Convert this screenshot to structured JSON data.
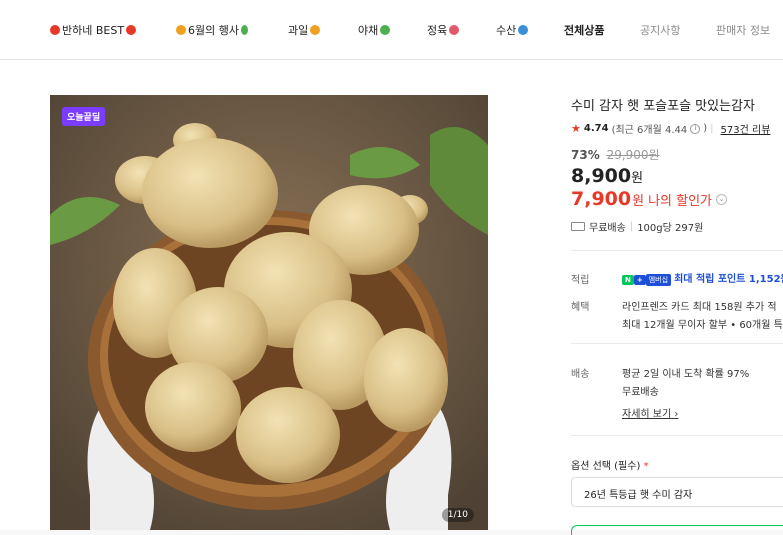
{
  "nav": [
    {
      "label": "반하네 BEST",
      "icon": "heart-icon",
      "color": "#e8382a"
    },
    {
      "label": "6월의 행사",
      "icon": "orange-icon",
      "color": "#f0a020"
    },
    {
      "label": "과일",
      "icon": "fruit-icon",
      "color": "#f0a020"
    },
    {
      "label": "야채",
      "icon": "vegetable-icon",
      "color": "#4caf50"
    },
    {
      "label": "정육",
      "icon": "meat-icon",
      "color": "#e05a6a"
    },
    {
      "label": "수산",
      "icon": "fish-icon",
      "color": "#3a8fd8"
    },
    {
      "label": "전체상품"
    },
    {
      "label": "공지사항"
    },
    {
      "label": "판매자 정보"
    }
  ],
  "product": {
    "badge": "오늘끝딜",
    "pager": "1/10",
    "title": "수미 감자 햇 포슬포슬 맛있는감자",
    "rating": "4.74",
    "rating_recent": "(최근 6개월 4.44",
    "rating_recent_close": ")",
    "reviews": "573건 리뷰",
    "discount_pct": "73%",
    "original_price": "29,900원",
    "price": "8,900",
    "price_unit": "원",
    "my_price": "7,900",
    "my_price_unit": "원",
    "my_price_label": "나의 할인가",
    "shipping": "무료배송",
    "unit_price": "100g당 297원"
  },
  "details": {
    "points_label": "적립",
    "points_npay": "N",
    "points_npay_plus": "+",
    "points_tag": "멤버십",
    "points_text": "최대 적립 포인트 1,152원",
    "benefit_label": "혜택",
    "benefit_line1": "라인프렌즈 카드 최대 158원 추가 적",
    "benefit_line2": "최대 12개월 무이자 할부 • 60개월 특",
    "delivery_label": "배송",
    "delivery_line1": "평균 2일 이내 도착 확률 97%",
    "delivery_line2": "무료배송",
    "more": "자세히 보기"
  },
  "option": {
    "label": "옵션 선택 (필수)",
    "required_mark": "*",
    "selected": "26년 특등급 햇 수미 감자"
  },
  "colors": {
    "accent_red": "#e8382a",
    "badge_purple": "#7a3cff",
    "npay_green": "#03c75a",
    "point_blue": "#1e4fd8"
  }
}
